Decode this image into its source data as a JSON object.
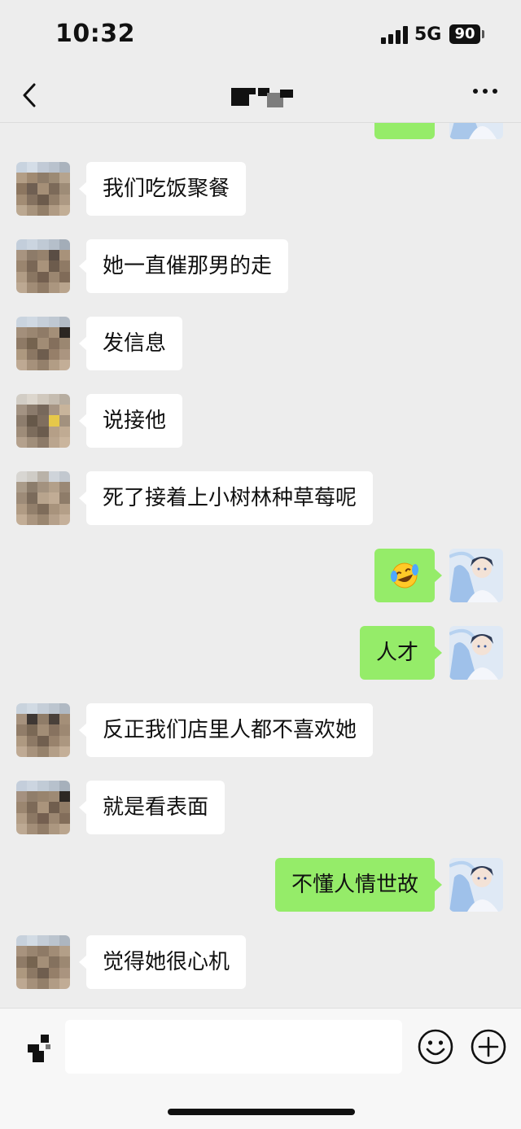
{
  "status_bar": {
    "time": "10:32",
    "network": "5G",
    "battery": "90"
  },
  "nav": {
    "back_icon": "chevron-left-icon",
    "more_icon": "ellipsis-icon"
  },
  "messages": [
    {
      "side": "left",
      "text": "我们吃饭聚餐"
    },
    {
      "side": "left",
      "text": "她一直催那男的走"
    },
    {
      "side": "left",
      "text": "发信息"
    },
    {
      "side": "left",
      "text": "说接他"
    },
    {
      "side": "left",
      "text": "死了接着上小树林种草莓呢"
    },
    {
      "side": "right",
      "emoji": "face-with-tears-of-joy-emoji"
    },
    {
      "side": "right",
      "text": "人才"
    },
    {
      "side": "left",
      "text": "反正我们店里人都不喜欢她"
    },
    {
      "side": "left",
      "text": "就是看表面"
    },
    {
      "side": "right",
      "text": "不懂人情世故"
    },
    {
      "side": "left",
      "text": "觉得她很心机"
    }
  ],
  "input_bar": {
    "voice_icon": "voice-icon",
    "input_value": "",
    "emoji_icon": "emoji-icon",
    "plus_icon": "plus-icon"
  },
  "colors": {
    "background": "#ededed",
    "incoming_bubble": "#ffffff",
    "outgoing_bubble": "#95ec69",
    "text": "#111111"
  }
}
